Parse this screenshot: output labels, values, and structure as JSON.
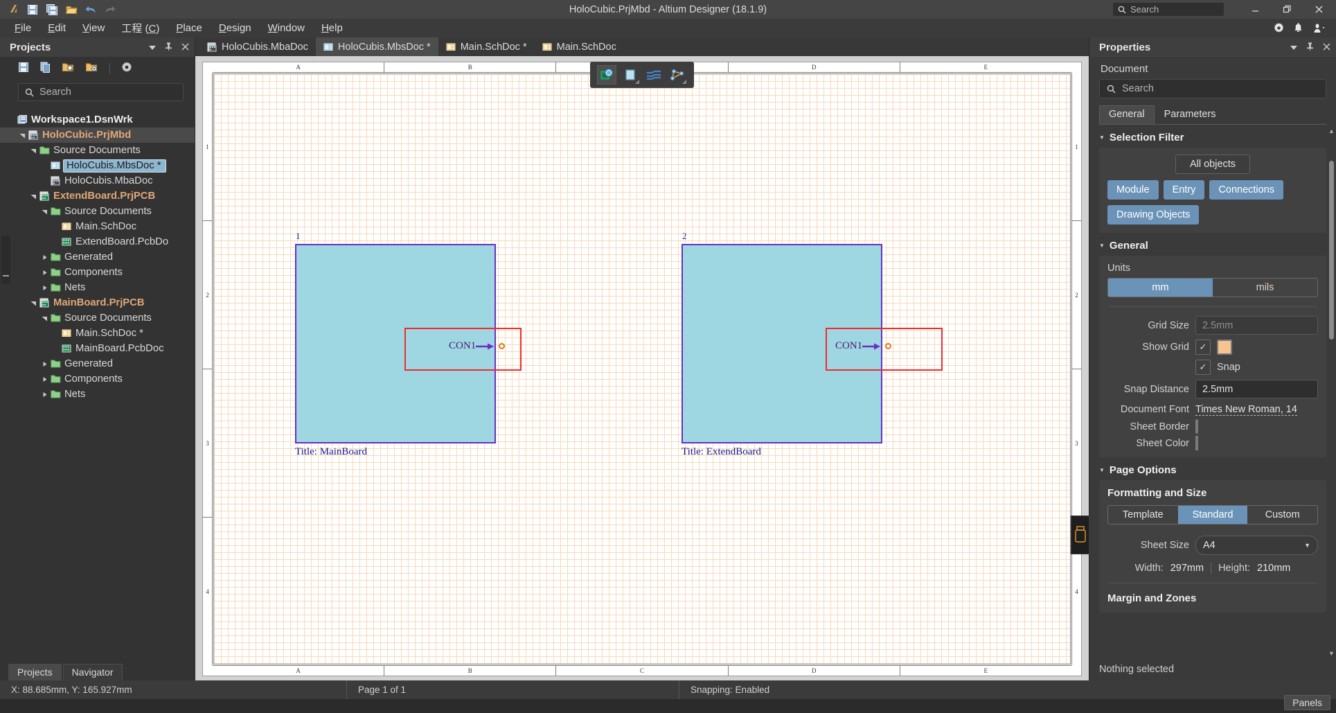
{
  "titlebar": {
    "title": "HoloCubic.PrjMbd - Altium Designer (18.1.9)",
    "search_placeholder": "Search",
    "quick_tools": [
      {
        "name": "altium-logo-icon",
        "label": "Altium"
      },
      {
        "name": "save-icon",
        "label": "Save"
      },
      {
        "name": "save-all-icon",
        "label": "Save All"
      },
      {
        "name": "open-folder-icon",
        "label": "Open"
      },
      {
        "name": "undo-icon",
        "label": "Undo"
      },
      {
        "name": "redo-icon",
        "label": "Redo"
      }
    ],
    "window_buttons": [
      {
        "name": "minimize-button",
        "glyph": "–"
      },
      {
        "name": "restore-button",
        "glyph": "❐"
      },
      {
        "name": "close-button",
        "glyph": "✕"
      }
    ]
  },
  "menubar": {
    "items": [
      {
        "pre": "",
        "acc": "F",
        "post": "ile"
      },
      {
        "pre": "",
        "acc": "E",
        "post": "dit"
      },
      {
        "pre": "",
        "acc": "V",
        "post": "iew"
      },
      {
        "pre": "工程 (",
        "acc": "C",
        "post": ")"
      },
      {
        "pre": "",
        "acc": "P",
        "post": "lace"
      },
      {
        "pre": "",
        "acc": "D",
        "post": "esign"
      },
      {
        "pre": "",
        "acc": "W",
        "post": "indow"
      },
      {
        "pre": "",
        "acc": "H",
        "post": "elp"
      }
    ],
    "right_icons": [
      "gear-icon",
      "bell-icon",
      "user-account-icon"
    ]
  },
  "projects_panel": {
    "title": "Projects",
    "header_buttons": [
      "collapse-chevron-icon",
      "pin-icon",
      "close-icon"
    ],
    "toolbar": [
      "save-icon",
      "copy-icon",
      "open-project-icon",
      "project-options-icon",
      "settings-gear-icon"
    ],
    "search_placeholder": "Search",
    "tree": [
      {
        "depth": 0,
        "arrow": "",
        "icon": "workspace-icon",
        "label": "Workspace1.DsnWrk",
        "style": "bold-white"
      },
      {
        "depth": 1,
        "arrow": "down",
        "icon": "mbd-project-icon",
        "label": "HoloCubic.PrjMbd",
        "style": "bold-orange",
        "row_highlight": true
      },
      {
        "depth": 2,
        "arrow": "down",
        "icon": "folder-icon",
        "label": "Source Documents",
        "style": "normal"
      },
      {
        "depth": 3,
        "arrow": "",
        "icon": "mbsdoc-icon",
        "label": "HoloCubis.MbsDoc *",
        "style": "selected"
      },
      {
        "depth": 3,
        "arrow": "",
        "icon": "mbadoc-icon",
        "label": "HoloCubis.MbaDoc",
        "style": "normal"
      },
      {
        "depth": 2,
        "arrow": "down",
        "icon": "pcb-project-icon",
        "label": "ExtendBoard.PrjPCB",
        "style": "bold-orange"
      },
      {
        "depth": 3,
        "arrow": "down",
        "icon": "folder-icon",
        "label": "Source Documents",
        "style": "normal"
      },
      {
        "depth": 4,
        "arrow": "",
        "icon": "schdoc-icon",
        "label": "Main.SchDoc",
        "style": "normal"
      },
      {
        "depth": 4,
        "arrow": "",
        "icon": "pcbdoc-icon",
        "label": "ExtendBoard.PcbDo",
        "style": "normal"
      },
      {
        "depth": 3,
        "arrow": "right",
        "icon": "folder-icon",
        "label": "Generated",
        "style": "normal"
      },
      {
        "depth": 3,
        "arrow": "right",
        "icon": "folder-icon",
        "label": "Components",
        "style": "normal"
      },
      {
        "depth": 3,
        "arrow": "right",
        "icon": "folder-icon",
        "label": "Nets",
        "style": "normal"
      },
      {
        "depth": 2,
        "arrow": "down",
        "icon": "pcb-project-icon",
        "label": "MainBoard.PrjPCB",
        "style": "bold-orange"
      },
      {
        "depth": 3,
        "arrow": "down",
        "icon": "folder-icon",
        "label": "Source Documents",
        "style": "normal"
      },
      {
        "depth": 4,
        "arrow": "",
        "icon": "schdoc-icon",
        "label": "Main.SchDoc *",
        "style": "normal"
      },
      {
        "depth": 4,
        "arrow": "",
        "icon": "pcbdoc-icon",
        "label": "MainBoard.PcbDoc",
        "style": "normal"
      },
      {
        "depth": 3,
        "arrow": "right",
        "icon": "folder-icon",
        "label": "Generated",
        "style": "normal"
      },
      {
        "depth": 3,
        "arrow": "right",
        "icon": "folder-icon",
        "label": "Components",
        "style": "normal"
      },
      {
        "depth": 3,
        "arrow": "right",
        "icon": "folder-icon",
        "label": "Nets",
        "style": "normal"
      }
    ],
    "bottom_tabs": [
      {
        "label": "Projects",
        "active": true
      },
      {
        "label": "Navigator",
        "active": false
      }
    ]
  },
  "document_tabs": [
    {
      "label": "HoloCubis.MbaDoc",
      "icon": "mbadoc-icon",
      "active": false
    },
    {
      "label": "HoloCubis.MbsDoc *",
      "icon": "mbsdoc-icon",
      "active": true
    },
    {
      "label": "Main.SchDoc *",
      "icon": "schdoc-icon",
      "active": false
    },
    {
      "label": "Main.SchDoc",
      "icon": "schdoc-icon",
      "active": false
    }
  ],
  "canvas": {
    "ruler_h": [
      "A",
      "B",
      "C",
      "D",
      "E"
    ],
    "ruler_v": [
      "1",
      "2",
      "3",
      "4"
    ],
    "float_toolbar": [
      {
        "name": "place-module-tool",
        "icon": "pcb-module-icon",
        "selected": true
      },
      {
        "name": "place-rectangle-tool",
        "icon": "rectangle-icon",
        "selected": false
      },
      {
        "name": "place-wire-tool",
        "icon": "wires-icon",
        "selected": false
      },
      {
        "name": "place-net-tool",
        "icon": "polygon-net-icon",
        "selected": false
      }
    ],
    "blocks": [
      {
        "number": "1",
        "title": "Title: MainBoard",
        "entry_label": "CON1",
        "pin": "pin-ring-icon"
      },
      {
        "number": "2",
        "title": "Title: ExtendBoard",
        "entry_label": "CON1",
        "pin": "pin-ring-icon"
      }
    ]
  },
  "statusbar": {
    "coordinates": "X: 88.685mm, Y: 165.927mm",
    "page": "Page 1 of 1",
    "snapping": "Snapping: Enabled",
    "panels_button": "Panels"
  },
  "properties_panel": {
    "title": "Properties",
    "header_buttons": [
      "collapse-chevron-icon",
      "pin-icon",
      "close-icon"
    ],
    "subtitle": "Document",
    "search_placeholder": "Search",
    "tabs": [
      {
        "label": "General",
        "active": true
      },
      {
        "label": "Parameters",
        "active": false
      }
    ],
    "selection_filter": {
      "heading": "Selection Filter",
      "all_objects": "All objects",
      "chips": [
        "Module",
        "Entry",
        "Connections",
        "Drawing Objects"
      ]
    },
    "general": {
      "heading": "General",
      "units_label": "Units",
      "units_options": [
        {
          "label": "mm",
          "active": true
        },
        {
          "label": "mils",
          "active": false
        }
      ],
      "grid_size_label": "Grid Size",
      "grid_size_value": "2.5mm",
      "show_grid_label": "Show Grid",
      "show_grid_checked": "✓",
      "grid_color": "#f6c48f",
      "snap_label": "Snap",
      "snap_checked": "✓",
      "snap_distance_label": "Snap Distance",
      "snap_distance_value": "2.5mm",
      "document_font_label": "Document Font",
      "document_font_value": "Times New Roman, 14",
      "sheet_border_label": "Sheet Border",
      "sheet_border_color": "#000000",
      "sheet_color_label": "Sheet Color",
      "sheet_color_value": "#ffffff"
    },
    "page_options": {
      "heading": "Page Options",
      "formatting_heading": "Formatting and Size",
      "format_options": [
        {
          "label": "Template",
          "active": false
        },
        {
          "label": "Standard",
          "active": true
        },
        {
          "label": "Custom",
          "active": false
        }
      ],
      "sheet_size_label": "Sheet Size",
      "sheet_size_value": "A4",
      "width_label": "Width:",
      "width_value": "297mm",
      "height_label": "Height:",
      "height_value": "210mm",
      "margin_heading": "Margin and Zones"
    },
    "footer": "Nothing selected"
  }
}
